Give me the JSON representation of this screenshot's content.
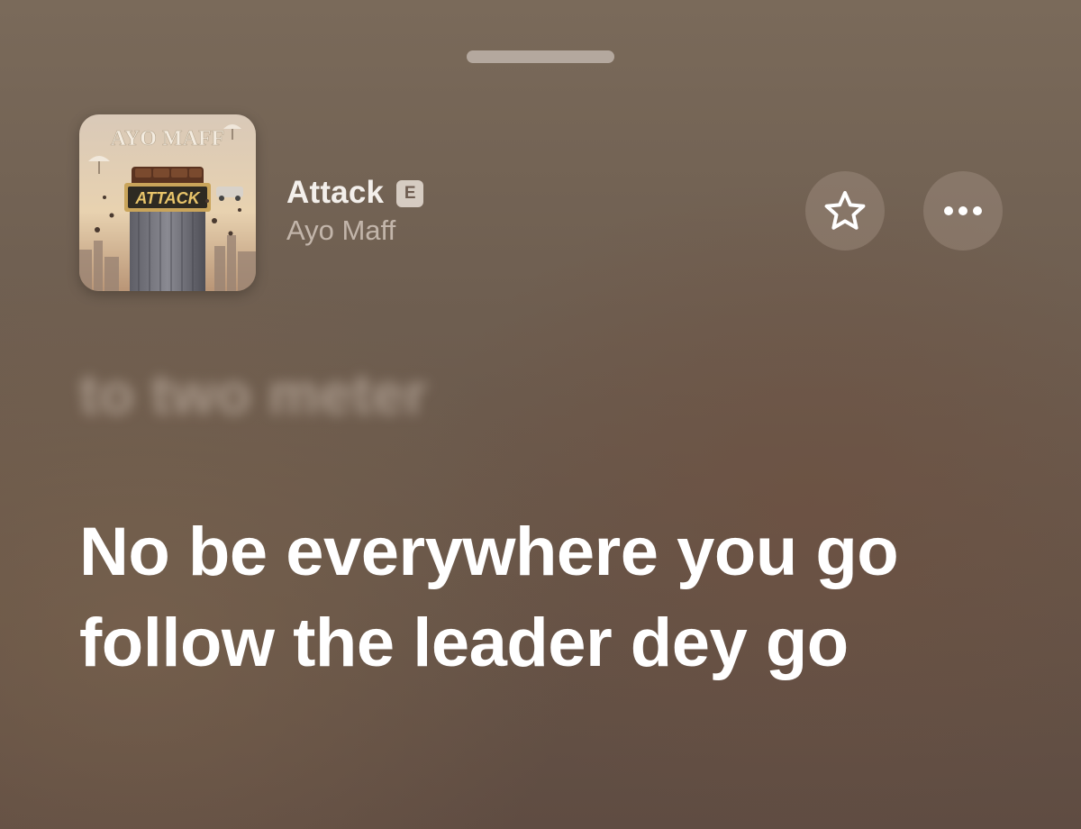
{
  "player": {
    "track_title": "Attack",
    "explicit_badge": "E",
    "artist": "Ayo Maff",
    "artwork_text": {
      "artist_lettering": "AYO MAFF",
      "title_lettering": "ATTACK"
    },
    "icons": {
      "favorite": "star-icon",
      "more": "ellipsis-icon"
    }
  },
  "lyrics": {
    "previous_line": "to two meter",
    "current_line": "No be everywhere you go follow the leader dey go"
  },
  "colors": {
    "text_primary": "#ffffff",
    "text_secondary": "#e2d6cc",
    "button_bg": "#aa988c"
  }
}
